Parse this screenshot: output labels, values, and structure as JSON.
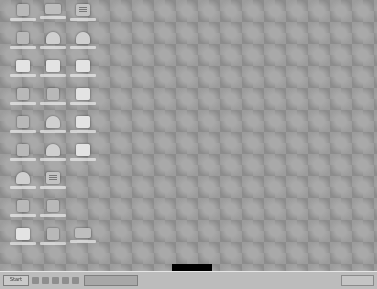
{
  "desktop": {
    "icons": [
      {
        "name": "my-computer-icon",
        "type": "app"
      },
      {
        "name": "network-icon",
        "type": "drive"
      },
      {
        "name": "recycle-bin-icon",
        "type": "doc"
      },
      {
        "name": "app-icon",
        "type": "app"
      },
      {
        "name": "app-icon",
        "type": "person"
      },
      {
        "name": "app-icon",
        "type": "person"
      },
      {
        "name": "folder-icon",
        "type": "folder"
      },
      {
        "name": "folder-icon",
        "type": "folder"
      },
      {
        "name": "folder-icon",
        "type": "folder"
      },
      {
        "name": "app-icon",
        "type": "app"
      },
      {
        "name": "app-icon",
        "type": "app"
      },
      {
        "name": "folder-icon",
        "type": "folder"
      },
      {
        "name": "app-icon",
        "type": "app"
      },
      {
        "name": "app-icon",
        "type": "person"
      },
      {
        "name": "folder-icon",
        "type": "folder"
      },
      {
        "name": "app-icon",
        "type": "app"
      },
      {
        "name": "app-icon",
        "type": "person"
      },
      {
        "name": "folder-icon",
        "type": "folder"
      },
      {
        "name": "app-icon",
        "type": "person"
      },
      {
        "name": "app-icon",
        "type": "doc"
      },
      {
        "name": "app-icon",
        "type": "app"
      },
      {
        "name": "app-icon",
        "type": "app"
      },
      {
        "name": "folder-icon",
        "type": "folder"
      },
      {
        "name": "app-icon",
        "type": "app"
      },
      {
        "name": "app-icon",
        "type": "drive"
      },
      {
        "name": "app-icon",
        "type": "drive"
      }
    ]
  },
  "taskbar": {
    "start_label": "Start"
  }
}
